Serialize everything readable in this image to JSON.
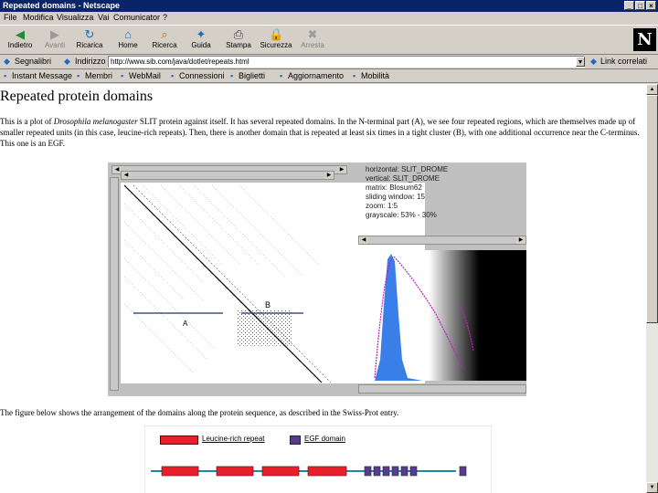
{
  "window": {
    "title": "Repeated domains - Netscape",
    "controls": [
      "_",
      "□",
      "×"
    ]
  },
  "menu": [
    "File",
    "Modifica",
    "Visualizza",
    "Vai",
    "Comunicator",
    "?"
  ],
  "toolbar": {
    "buttons": [
      {
        "label": "Indietro",
        "icon": "back-icon",
        "enabled": true
      },
      {
        "label": "Avanti",
        "icon": "forward-icon",
        "enabled": false
      },
      {
        "label": "Ricarica",
        "icon": "reload-icon",
        "enabled": true
      },
      {
        "label": "Home",
        "icon": "home-icon",
        "enabled": true
      },
      {
        "label": "Ricerca",
        "icon": "search-icon",
        "enabled": true
      },
      {
        "label": "Guida",
        "icon": "guide-icon",
        "enabled": true
      },
      {
        "label": "Stampa",
        "icon": "print-icon",
        "enabled": true
      },
      {
        "label": "Sicurezza",
        "icon": "security-icon",
        "enabled": true
      },
      {
        "label": "Arresta",
        "icon": "stop-icon",
        "enabled": false
      }
    ],
    "logo": "N"
  },
  "location": {
    "bookmarks_label": "Segnalibri",
    "address_label": "Indirizzo",
    "url": "http://www.sib.com/java/dotlet/repeats.html",
    "related_label": "Link correlati"
  },
  "personal_bar": [
    "Instant Message",
    "Membri",
    "WebMail",
    "Connessioni",
    "Biglietti",
    "Aggiornamento",
    "Mobilità"
  ],
  "page": {
    "heading": "Repeated protein domains",
    "para_pre": "This is a plot of ",
    "para_species": "Drosophila melanogaster",
    "para_post": " SLIT protein against itself. It has several repeated domains. In the N-terminal part (A), we see four repeated regions, which are themselves made up of smaller repeated units (in this case, leucine-rich repeats). Then, there is another domain that is repeated at least six times in a tight cluster (B), with one additional occurrence near the C-terminus. This one is an EGF.",
    "para2": "The figure below shows the arrangement of the domains along the protein sequence, as described in the Swiss-Prot entry.",
    "plot_label_a": "A",
    "plot_label_b": "B"
  },
  "applet": {
    "params": [
      "horizontal: SLIT_DROME",
      "vertical: SLIT_DROME",
      "matrix: Blosum62",
      "sliding window: 15",
      "zoom: 1:5",
      "grayscale: 53% - 30%"
    ]
  },
  "domain_figure": {
    "legend": [
      {
        "label": "Leucine-rich repeat",
        "color": "#e8202c"
      },
      {
        "label": "EGF domain",
        "color": "#5a3c8c"
      }
    ]
  },
  "colors": {
    "titlebar": "#0a246a",
    "lrr": "#e8202c",
    "egf": "#5a3c8c",
    "histogram": "#3a7ee8",
    "curve": "#c020c0"
  }
}
